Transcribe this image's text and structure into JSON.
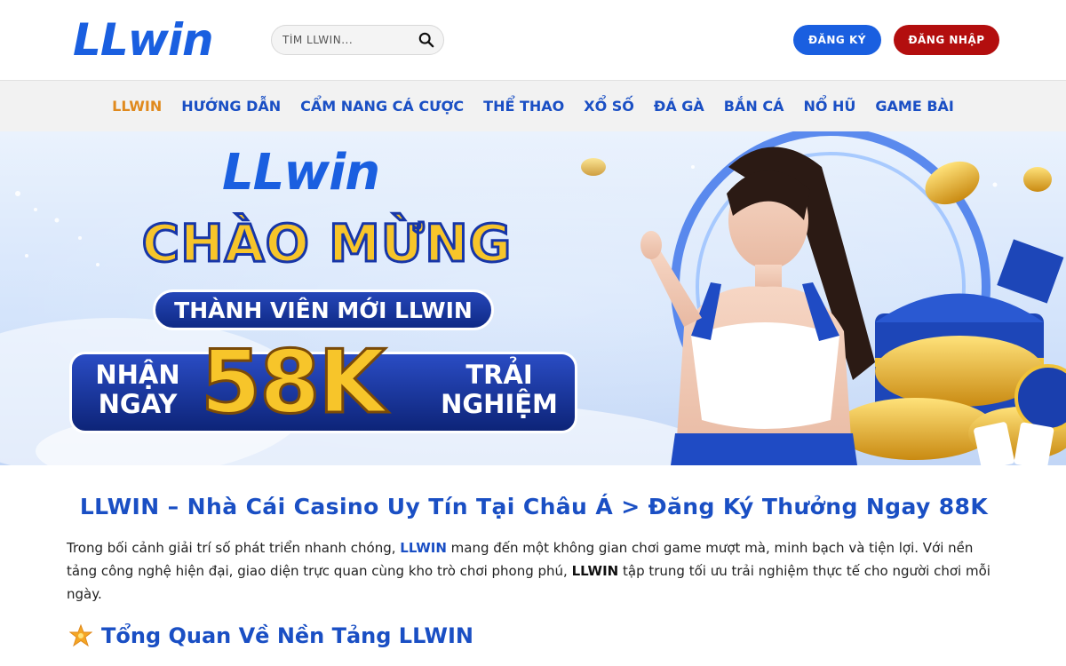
{
  "header": {
    "logo": "LLwin",
    "search_placeholder": "TÌM LLWIN...",
    "register_label": "ĐĂNG KÝ",
    "login_label": "ĐĂNG NHẬP"
  },
  "nav": {
    "items": [
      "LLWIN",
      "HƯỚNG DẪN",
      "CẨM NANG CÁ CƯỢC",
      "THỂ THAO",
      "XỔ SỐ",
      "ĐÁ GÀ",
      "BẮN CÁ",
      "NỔ HŨ",
      "GAME BÀI"
    ],
    "active_index": 0
  },
  "banner": {
    "logo": "LLwin",
    "welcome": "CHÀO MỪNG",
    "subtitle": "THÀNH VIÊN MỚI LLWIN",
    "left_line1": "NHẬN",
    "left_line2": "NGAY",
    "amount": "58K",
    "right_line1": "TRẢI",
    "right_line2": "NGHIỆM"
  },
  "content": {
    "title": "LLWIN – Nhà Cái Casino Uy Tín Tại Châu Á > Đăng Ký Thưởng Ngay 88K",
    "para_part1": "Trong bối cảnh giải trí số phát triển nhanh chóng, ",
    "para_brand1": "LLWIN",
    "para_part2": " mang đến một không gian chơi game mượt mà, minh bạch và tiện lợi. Với nền tảng công nghệ hiện đại, giao diện trực quan cùng kho trò chơi phong phú, ",
    "para_brand2": "LLWIN",
    "para_part3": " tập trung tối ưu trải nghiệm thực tế cho người chơi mỗi ngày.",
    "section_heading": "Tổng Quan Về Nền Tảng LLWIN"
  },
  "colors": {
    "brand_blue": "#1a5fe0",
    "nav_blue": "#1a4fc4",
    "nav_active": "#e08a1e",
    "login_red": "#b30e0e",
    "gold": "#f7c52a"
  },
  "icons": {
    "search": "search-icon",
    "star": "star-icon"
  }
}
